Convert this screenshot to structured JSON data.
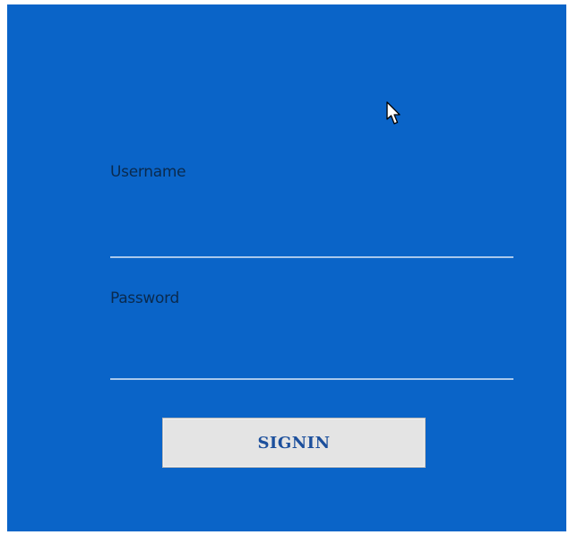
{
  "form": {
    "username_label": "Username",
    "username_value": "",
    "password_label": "Password",
    "password_value": "",
    "signin_label": "SIGNIN"
  },
  "colors": {
    "panel_background": "#0a64c8",
    "label_text": "#0a2a4e",
    "input_underline": "#a9c8ec",
    "button_background": "#e4e4e4",
    "button_text": "#1c4f9c"
  },
  "icons": {
    "pointer": "mouse-pointer-icon"
  }
}
